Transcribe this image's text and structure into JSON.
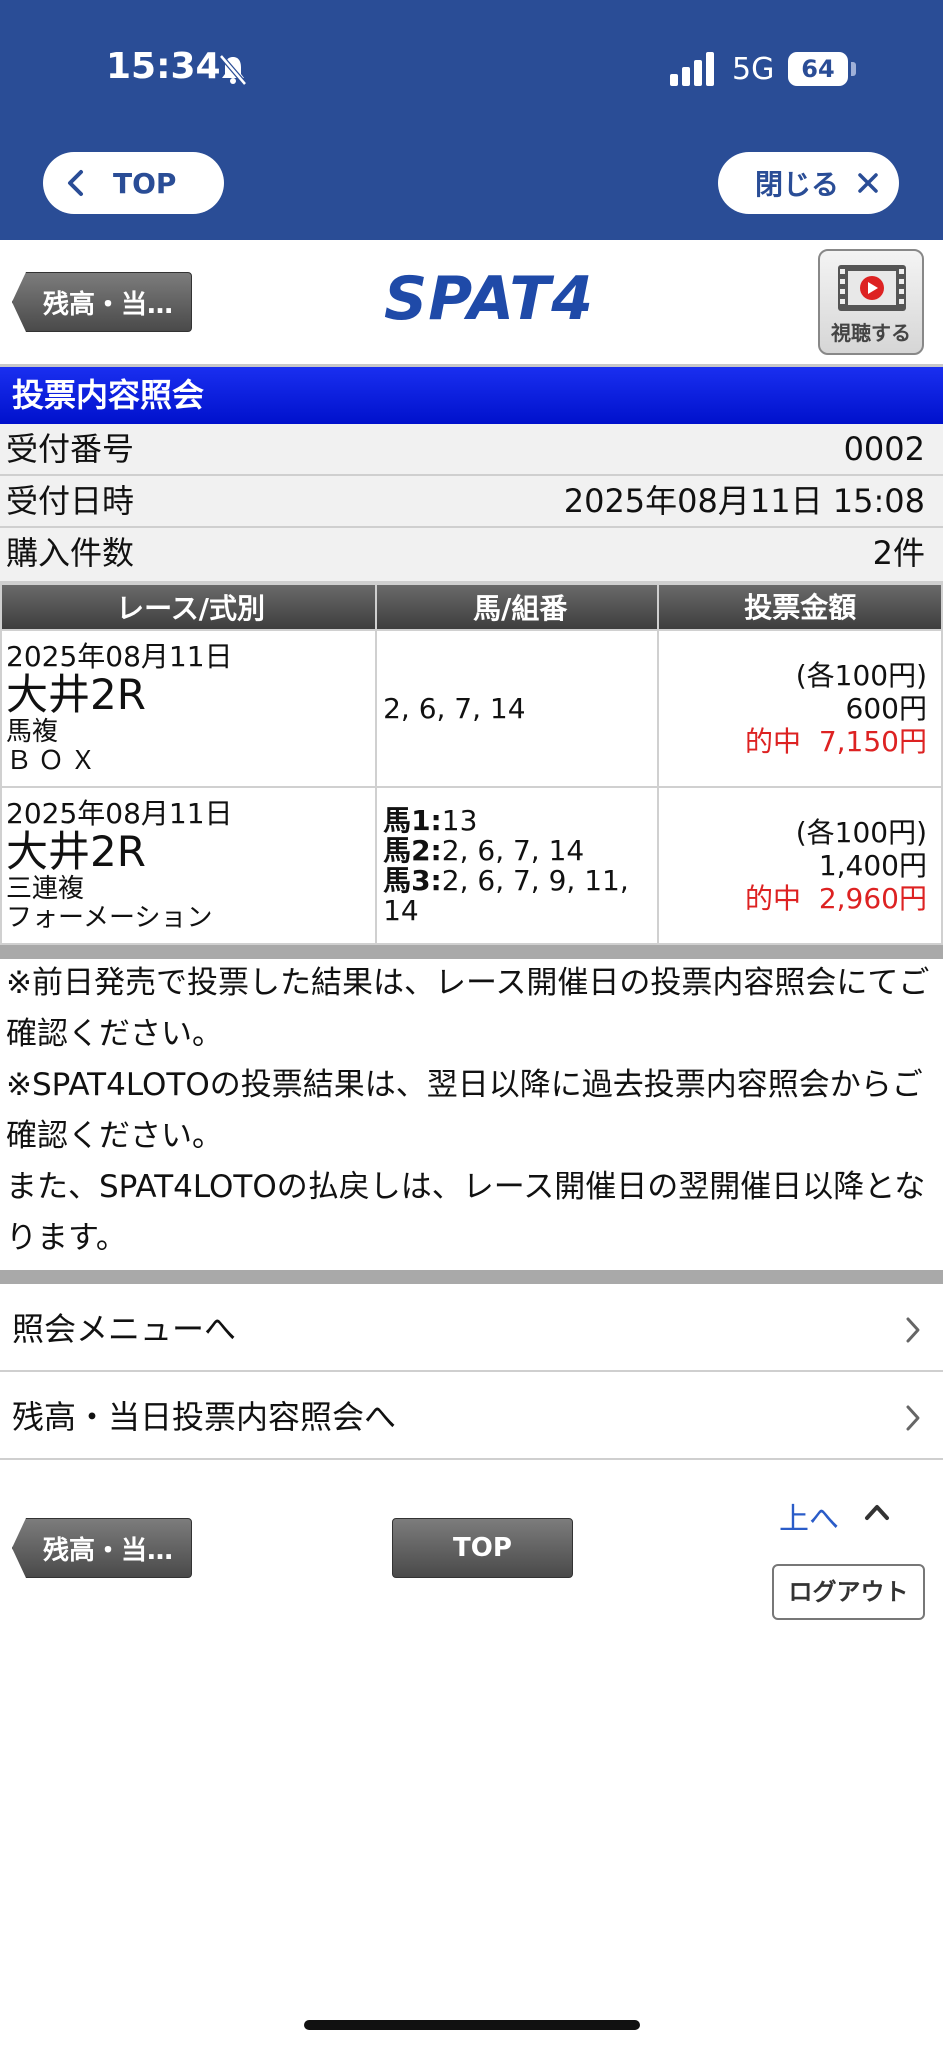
{
  "status_bar": {
    "time": "15:34",
    "network": "5G",
    "battery": "64"
  },
  "nav": {
    "top_label": "TOP",
    "close_label": "閉じる"
  },
  "header": {
    "back_label": "残高・当…",
    "logo": "SPAT4",
    "watch_label": "視聴する"
  },
  "page": {
    "title": "投票内容照会"
  },
  "info": [
    {
      "label": "受付番号",
      "value": "0002"
    },
    {
      "label": "受付日時",
      "value": "2025年08月11日 15:08"
    },
    {
      "label": "購入件数",
      "value": "2件"
    }
  ],
  "table": {
    "headers": [
      "レース/式別",
      "馬/組番",
      "投票金額"
    ],
    "rows": [
      {
        "date": "2025年08月11日",
        "race": "大井2R",
        "bet_type": "馬複",
        "method": "ＢＯＸ",
        "numbers": "2, 6, 7, 14",
        "unit": "(各100円)",
        "amount": "600円",
        "hit_label": "的中",
        "hit_value": "7,150円"
      },
      {
        "date": "2025年08月11日",
        "race": "大井2R",
        "bet_type": "三連複",
        "method": "フォーメーション",
        "formation": [
          {
            "label": "馬1:",
            "values": "13"
          },
          {
            "label": "馬2:",
            "values": "2, 6, 7, 14"
          },
          {
            "label": "馬3:",
            "values": "2, 6, 7, 9, 11, 14"
          }
        ],
        "unit": "(各100円)",
        "amount": "1,400円",
        "hit_label": "的中",
        "hit_value": "2,960円"
      }
    ]
  },
  "notes": [
    "※前日発売で投票した結果は、レース開催日の投票内容照会にてご確認ください。",
    "※SPAT4LOTOの投票結果は、翌日以降に過去投票内容照会からご確認ください。",
    "また、SPAT4LOTOの払戻しは、レース開催日の翌開催日以降となります。"
  ],
  "menu": [
    {
      "label": "照会メニューへ"
    },
    {
      "label": "残高・当日投票内容照会へ"
    }
  ],
  "footer": {
    "back_label": "残高・当…",
    "top_label": "TOP",
    "up_label": "上へ",
    "logout_label": "ログアウト"
  },
  "colors": {
    "nav_blue": "#2a4d96",
    "title_blue": "#0011cc",
    "hit_red": "#dd2222"
  }
}
